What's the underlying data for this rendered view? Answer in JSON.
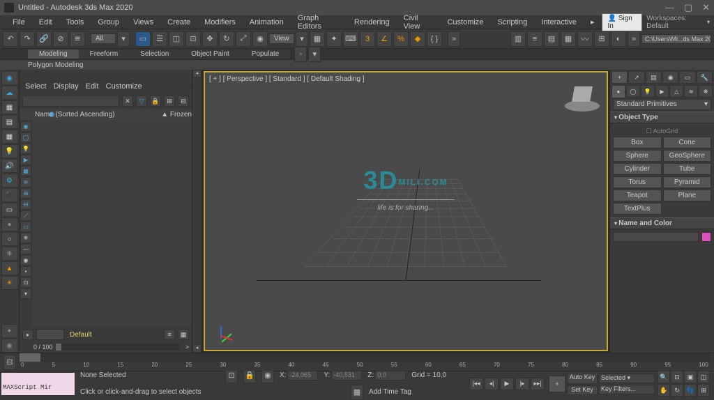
{
  "titlebar": {
    "text": "Untitled - Autodesk 3ds Max 2020"
  },
  "menubar": {
    "items": [
      "File",
      "Edit",
      "Tools",
      "Group",
      "Views",
      "Create",
      "Modifiers",
      "Animation",
      "Graph Editors",
      "Rendering",
      "Civil View",
      "Customize",
      "Scripting",
      "Interactive"
    ],
    "signin": "Sign In",
    "workspaces_label": "Workspaces:",
    "workspaces_value": "Default"
  },
  "toolbar": {
    "all": "All",
    "view": "View",
    "path": "C:\\Users\\Mi...ds Max 2020"
  },
  "ribbon": {
    "tabs": [
      "Modeling",
      "Freeform",
      "Selection",
      "Object Paint",
      "Populate"
    ],
    "sub": "Polygon Modeling"
  },
  "scene": {
    "menus": [
      "Select",
      "Display",
      "Edit",
      "Customize"
    ],
    "header_name": "Name (Sorted Ascending)",
    "header_frozen": "▲ Frozen",
    "default_label": "Default",
    "range": "0 / 100"
  },
  "viewport": {
    "label": "[ + ] [ Perspective ] [ Standard ] [ Default Shading ]",
    "watermark_brand": "MILI.COM",
    "watermark_tag": "life is for sharing..."
  },
  "cmd": {
    "dropdown": "Standard Primitives",
    "rollout1": "Object Type",
    "autogrid": "AutoGrid",
    "buttons": [
      "Box",
      "Cone",
      "Sphere",
      "GeoSphere",
      "Cylinder",
      "Tube",
      "Torus",
      "Pyramid",
      "Teapot",
      "Plane",
      "TextPlus",
      ""
    ],
    "rollout2": "Name and Color"
  },
  "timeline": {
    "ticks": [
      "0",
      "5",
      "10",
      "15",
      "20",
      "25",
      "30",
      "35",
      "40",
      "45",
      "50",
      "55",
      "60",
      "65",
      "70",
      "75",
      "80",
      "85",
      "90",
      "95",
      "100"
    ]
  },
  "status": {
    "maxscript": "MAXScript Mir",
    "none_selected": "None Selected",
    "hint": "Click or click-and-drag to select objects",
    "x_label": "X:",
    "x_val": "-24,065",
    "y_label": "Y:",
    "y_val": "-40,531",
    "z_label": "Z:",
    "z_val": "0,0",
    "grid": "Grid = 10,0",
    "add_time_tag": "Add Time Tag",
    "autokey": "Auto Key",
    "selected": "Selected",
    "setkey": "Set Key",
    "keyfilters": "Key Filters..."
  }
}
